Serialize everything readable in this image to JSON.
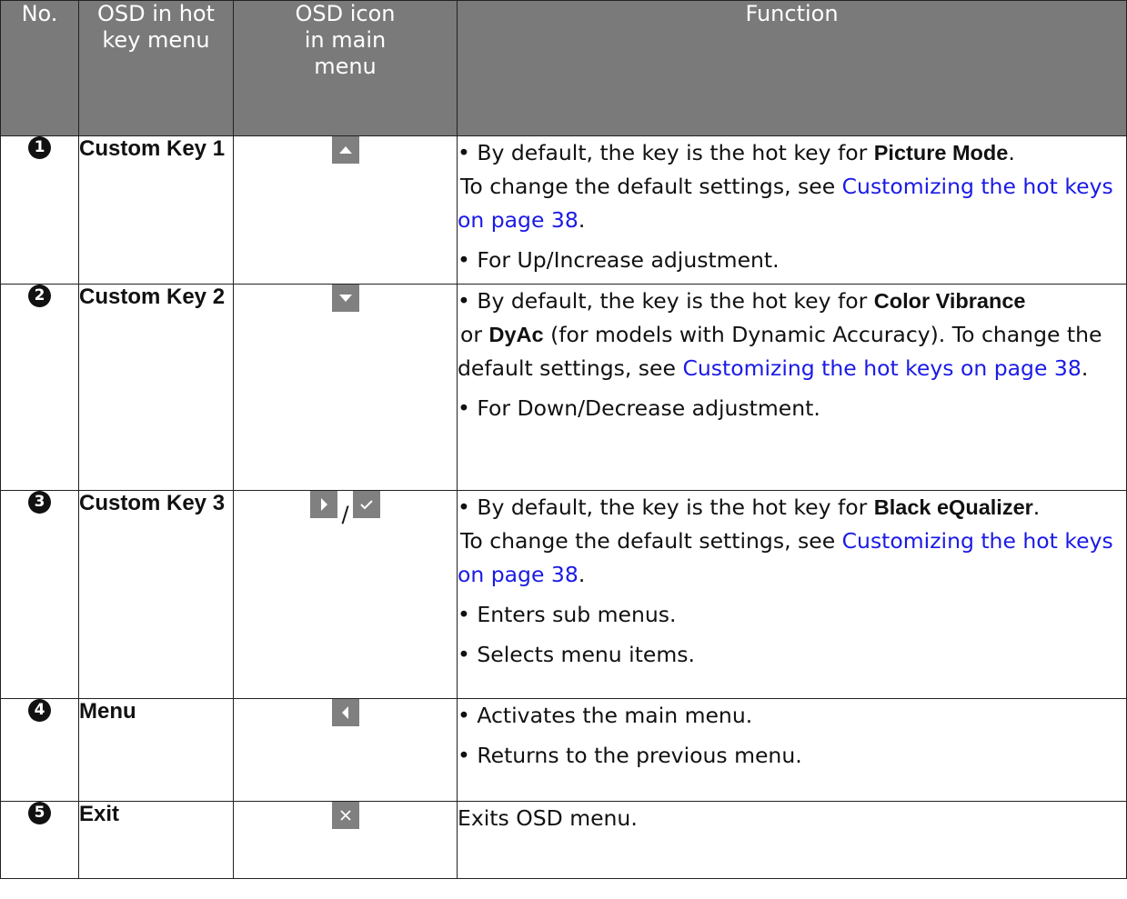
{
  "headers": {
    "no": "No.",
    "osd_hot_key": "OSD in hot key menu",
    "osd_icon": "OSD icon in main menu",
    "function": "Function"
  },
  "rows": [
    {
      "num": "1",
      "name": "Custom Key 1",
      "icons": [
        "up-triangle"
      ],
      "fn": {
        "b1_pre": "By default, the key is the hot key for ",
        "b1_bold": "Picture Mode",
        "b1_after": ".",
        "b1_line2": "To change the default settings, see ",
        "b1_link": "Customizing the hot keys on page 38",
        "b1_end": ".",
        "b2": "For Up/Increase adjustment."
      }
    },
    {
      "num": "2",
      "name": "Custom Key 2",
      "icons": [
        "down-triangle"
      ],
      "fn": {
        "b1_pre": "By default, the key is the hot key for ",
        "b1_bold": "Color Vibrance",
        "b1_or": "or ",
        "b1_bold2": "DyAc",
        "b1_mid": " (for models with Dynamic Accuracy). To change the default settings, see ",
        "b1_link": "Customizing the hot keys on page 38",
        "b1_end": ".",
        "b2": "For Down/Decrease adjustment."
      }
    },
    {
      "num": "3",
      "name": "Custom Key 3",
      "icons": [
        "right-triangle",
        "checkmark"
      ],
      "icon_separator": "/",
      "fn": {
        "b1_pre": "By default, the key is the hot key for ",
        "b1_bold": "Black eQualizer",
        "b1_after": ".",
        "b1_line2": "To change the default settings, see ",
        "b1_link": "Customizing the hot keys on page 38",
        "b1_end": ".",
        "b2": "Enters sub menus.",
        "b3": "Selects menu items."
      }
    },
    {
      "num": "4",
      "name": "Menu",
      "icons": [
        "left-triangle"
      ],
      "fn": {
        "b1": "Activates the main menu.",
        "b2": "Returns to the previous menu."
      }
    },
    {
      "num": "5",
      "name": "Exit",
      "icons": [
        "close-x"
      ],
      "fn": {
        "plain": "Exits OSD menu."
      }
    }
  ],
  "colors": {
    "header_bg": "#7a7a7a",
    "icon_bg": "#808080",
    "link": "#1a1ae6"
  }
}
